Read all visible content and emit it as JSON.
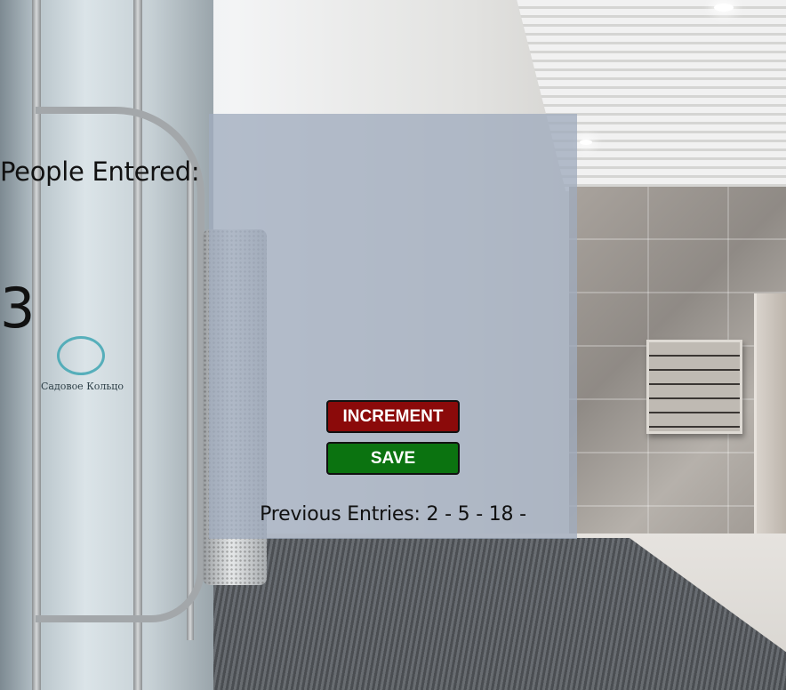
{
  "counter": {
    "title": "People Entered:",
    "count": "3",
    "increment_label": "INCREMENT",
    "save_label": "SAVE",
    "previous_label": "Previous Entries:",
    "previous_entries": "2 - 5 - 18 -"
  },
  "background": {
    "door_logo_text": "Садовое Кольцо"
  },
  "colors": {
    "increment_button": "#8b0a0a",
    "save_button": "#0b7310",
    "card_overlay": "#a0acbe"
  }
}
